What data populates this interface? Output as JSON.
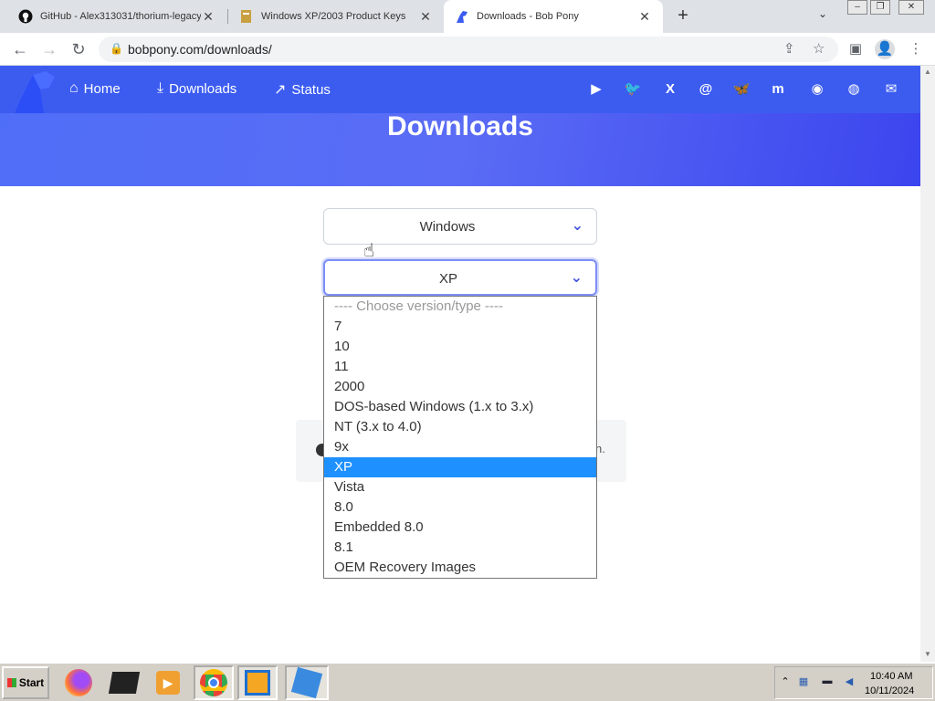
{
  "browser": {
    "tabs": [
      {
        "title": "GitHub - Alex313031/thorium-legacy",
        "close": "✕",
        "icon": "github-icon"
      },
      {
        "title": "Windows XP/2003 Product Keys",
        "close": "✕",
        "icon": "page-icon"
      },
      {
        "title": "Downloads - Bob Pony",
        "close": "✕",
        "icon": "bobpony-icon",
        "active": true
      }
    ],
    "new_tab": "+",
    "url": "bobpony.com/downloads/",
    "window_controls": [
      "–",
      "❐",
      "✕"
    ]
  },
  "site": {
    "nav": [
      {
        "label": "Home",
        "icon": "home-icon",
        "glyph": "⌂"
      },
      {
        "label": "Downloads",
        "icon": "download-icon",
        "glyph": "⤓"
      },
      {
        "label": "Status",
        "icon": "trend-icon",
        "glyph": "↗"
      }
    ],
    "social": [
      {
        "icon": "youtube-icon",
        "glyph": "▶"
      },
      {
        "icon": "twitter-icon",
        "glyph": "🐦"
      },
      {
        "icon": "x-icon",
        "glyph": "X"
      },
      {
        "icon": "threads-icon",
        "glyph": "@"
      },
      {
        "icon": "bluesky-icon",
        "glyph": "🦋"
      },
      {
        "icon": "mastodon-icon",
        "glyph": "m"
      },
      {
        "icon": "discord-icon",
        "glyph": "◉"
      },
      {
        "icon": "github-icon",
        "glyph": "◍"
      },
      {
        "icon": "mail-icon",
        "glyph": "✉"
      }
    ],
    "page_title": "Downloads",
    "os_select": {
      "value": "Windows"
    },
    "version_select": {
      "value": "XP",
      "options": [
        "---- Choose version/type ----",
        "7",
        "10",
        "11",
        "2000",
        "DOS-based Windows (1.x to 3.x)",
        "NT (3.x to 4.0)",
        "9x",
        "XP",
        "Vista",
        "8.0",
        "Embedded 8.0",
        "8.1",
        "OEM Recovery Images"
      ],
      "selected_index": 8
    },
    "behind_text": "n."
  },
  "taskbar": {
    "start_label": "Start",
    "time": "10:40 AM",
    "date": "10/11/2024"
  },
  "colors": {
    "brand": "#3c5cf0",
    "selection": "#1e90ff"
  }
}
